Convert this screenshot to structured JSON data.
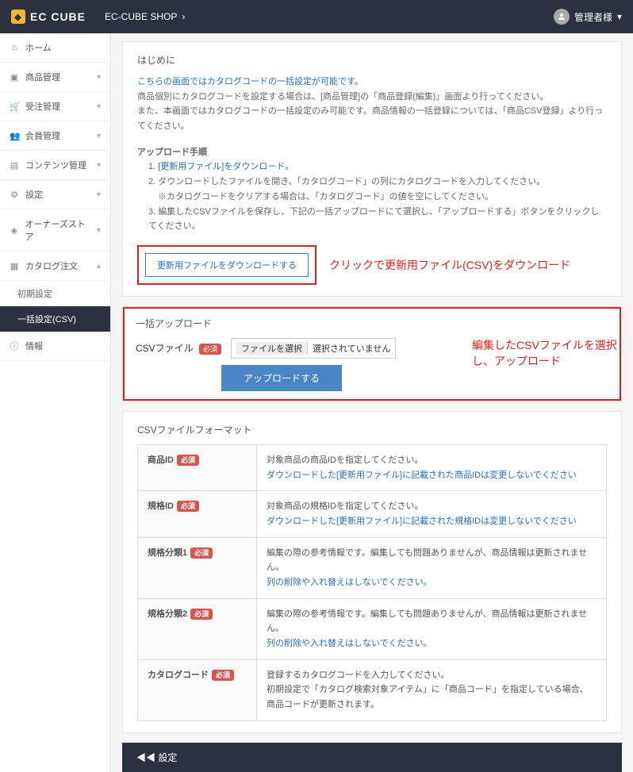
{
  "header": {
    "logo": "EC CUBE",
    "shop_name": "EC-CUBE SHOP",
    "user_name": "管理者様"
  },
  "sidebar": {
    "items": [
      {
        "icon": "home",
        "label": "ホーム"
      },
      {
        "icon": "cart",
        "label": "商品管理"
      },
      {
        "icon": "order",
        "label": "受注管理"
      },
      {
        "icon": "member",
        "label": "会員管理"
      },
      {
        "icon": "content",
        "label": "コンテンツ管理"
      },
      {
        "icon": "setting",
        "label": "設定"
      },
      {
        "icon": "owner",
        "label": "オーナーズストア"
      },
      {
        "icon": "catalog",
        "label": "カタログ注文"
      }
    ],
    "sub": [
      {
        "label": "初期設定"
      },
      {
        "label": "一括設定(CSV)",
        "active": true
      }
    ],
    "info": "情報"
  },
  "intro": {
    "title": "はじめに",
    "line1": "こちらの画面ではカタログコードの一括設定が可能です。",
    "line2": "商品個別にカタログコードを設定する場合は、[商品管理]の「商品登録(編集)」画面より行ってください。",
    "line3": "また、本画面ではカタログコードの一括設定のみ可能です。商品情報の一括登録については、「商品CSV登録」より行ってください。"
  },
  "upload_steps": {
    "title": "アップロード手順",
    "step1a": "1. ",
    "step1b": "[更新用ファイル]をダウンロード。",
    "step2": "2. ダウンロードしたファイルを開き、「カタログコード」の列にカタログコードを入力してください。",
    "step2b": "※カタログコードをクリアする場合は、「カタログコード」の値を空にしてください。",
    "step3": "3. 編集したCSVファイルを保存し、下記の一括アップロードにて選択し、「アップロードする」ボタンをクリックしてください。"
  },
  "download": {
    "button": "更新用ファイルをダウンロードする",
    "annotation": "クリックで更新用ファイル(CSV)をダウンロード"
  },
  "upload": {
    "title": "一括アップロード",
    "field_label": "CSVファイル",
    "required": "必須",
    "file_select": "ファイルを選択",
    "file_none": "選択されていません",
    "button": "アップロードする",
    "annotation": "編集したCSVファイルを選択し、アップロード"
  },
  "format": {
    "title": "CSVファイルフォーマット",
    "rows": [
      {
        "name": "商品ID",
        "required": true,
        "desc1": "対象商品の商品IDを指定してください。",
        "desc2": "ダウンロードした[更新用ファイル]に記載された商品IDは変更しないでください",
        "desc2_link": true
      },
      {
        "name": "規格ID",
        "required": true,
        "desc1": "対象商品の規格IDを指定してください。",
        "desc2": "ダウンロードした[更新用ファイル]に記載された規格IDは変更しないでください",
        "desc2_link": true
      },
      {
        "name": "規格分類1",
        "required": true,
        "desc1": "編集の際の参考情報です。編集しても問題ありませんが、商品情報は更新されません。",
        "desc2": "列の削除や入れ替えはしないでください。",
        "desc2_link": true
      },
      {
        "name": "規格分類2",
        "required": true,
        "desc1": "編集の際の参考情報です。編集しても問題ありませんが、商品情報は更新されません。",
        "desc2": "列の削除や入れ替えはしないでください。",
        "desc2_link": true
      },
      {
        "name": "カタログコード",
        "required": true,
        "desc1": "登録するカタログコードを入力してください。",
        "desc2": "初期設定で「カタログ検索対象アイテム」に「商品コード」を指定している場合、商品コードが更新されます。",
        "desc2_link": false
      }
    ]
  },
  "footer": {
    "label": "設定"
  }
}
